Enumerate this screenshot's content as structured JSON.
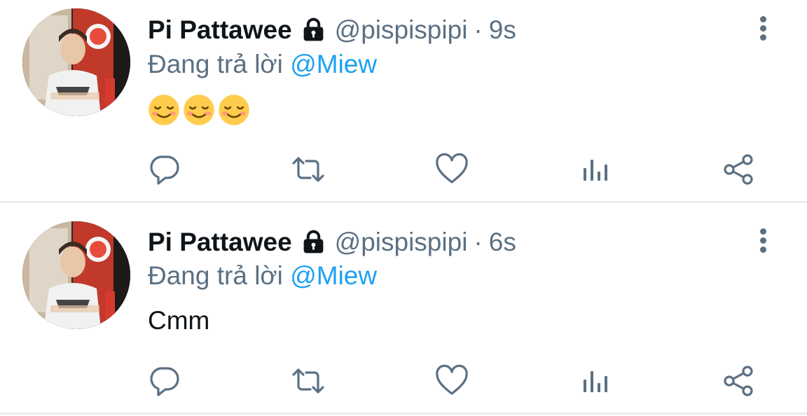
{
  "tweets": [
    {
      "display_name": "Pi Pattawee",
      "handle": "@pispispipi",
      "separator": "·",
      "time": "9s",
      "reply_prefix": "Đang trả lời ",
      "reply_mention": "@Miew",
      "content_text": "",
      "content_emojis": [
        "😌",
        "😌",
        "😌"
      ]
    },
    {
      "display_name": "Pi Pattawee",
      "handle": "@pispispipi",
      "separator": "·",
      "time": "6s",
      "reply_prefix": "Đang trả lời ",
      "reply_mention": "@Miew",
      "content_text": "Cmm",
      "content_emojis": []
    }
  ],
  "icons": {
    "lock": "lock-icon",
    "more": "more-vertical-icon",
    "actions": [
      "reply-icon",
      "retweet-icon",
      "like-icon",
      "analytics-icon",
      "share-icon"
    ]
  },
  "colors": {
    "text": "#0f1419",
    "secondary": "#5b7083",
    "link": "#1da1f2",
    "divider": "#e6ecf0"
  }
}
